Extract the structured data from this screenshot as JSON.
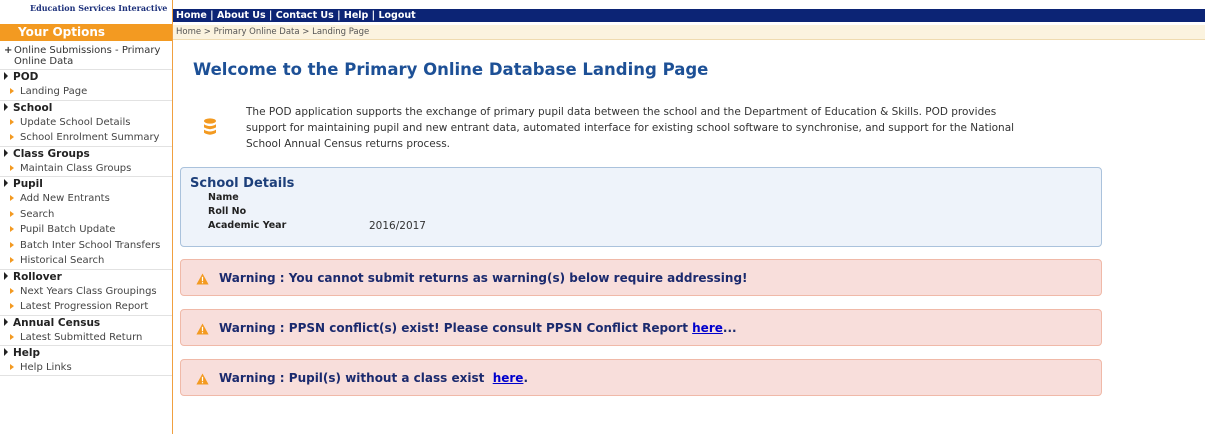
{
  "brand": "Education Services Interactive",
  "sidebar": {
    "header": "Your Options",
    "top_item": "Online Submissions - Primary Online Data",
    "sections": [
      {
        "label": "POD",
        "items": [
          "Landing Page"
        ]
      },
      {
        "label": "School",
        "items": [
          "Update School Details",
          "School Enrolment Summary"
        ]
      },
      {
        "label": "Class Groups",
        "items": [
          "Maintain Class Groups"
        ]
      },
      {
        "label": "Pupil",
        "items": [
          "Add New Entrants",
          "Search",
          "Pupil Batch Update",
          "Batch Inter School Transfers",
          "Historical Search"
        ]
      },
      {
        "label": "Rollover",
        "items": [
          "Next Years Class Groupings",
          "Latest Progression Report"
        ]
      },
      {
        "label": "Annual Census",
        "items": [
          "Latest Submitted Return"
        ]
      },
      {
        "label": "Help",
        "items": [
          "Help Links"
        ]
      }
    ]
  },
  "topnav": {
    "home": "Home",
    "about": "About Us",
    "contact": "Contact Us",
    "help": "Help",
    "logout": "Logout",
    "separator": "|"
  },
  "breadcrumb": "Home > Primary Online Data > Landing Page",
  "main": {
    "title": "Welcome to the Primary Online Database Landing Page",
    "intro": "The POD application supports the exchange of primary pupil data between the school and the Department of Education & Skills. POD provides support for maintaining pupil and new entrant data, automated interface for existing school software to synchronise, and support for the National School Annual Census returns process."
  },
  "school_details": {
    "title": "School Details",
    "name_label": "Name",
    "name_value": "",
    "roll_label": "Roll No",
    "roll_value": "",
    "year_label": "Academic Year",
    "year_value": "2016/2017"
  },
  "warnings": {
    "w1": "Warning : You cannot submit returns as warning(s) below require addressing!",
    "w2_text": "Warning : PPSN conflict(s) exist! Please consult PPSN Conflict Report ",
    "w2_link": "here",
    "w2_suffix": "...",
    "w3_text": "Warning : Pupil(s) without a class exist  ",
    "w3_link": "here",
    "w3_suffix": "."
  },
  "colors": {
    "accent_orange": "#f39a21",
    "nav_blue": "#0c2475",
    "title_blue": "#1d5096",
    "warning_bg": "#f8dedb"
  },
  "icons": {
    "database": "database-icon",
    "warning": "warning-triangle-icon",
    "section": "triangle-right-icon",
    "item": "orange-arrow-icon"
  }
}
